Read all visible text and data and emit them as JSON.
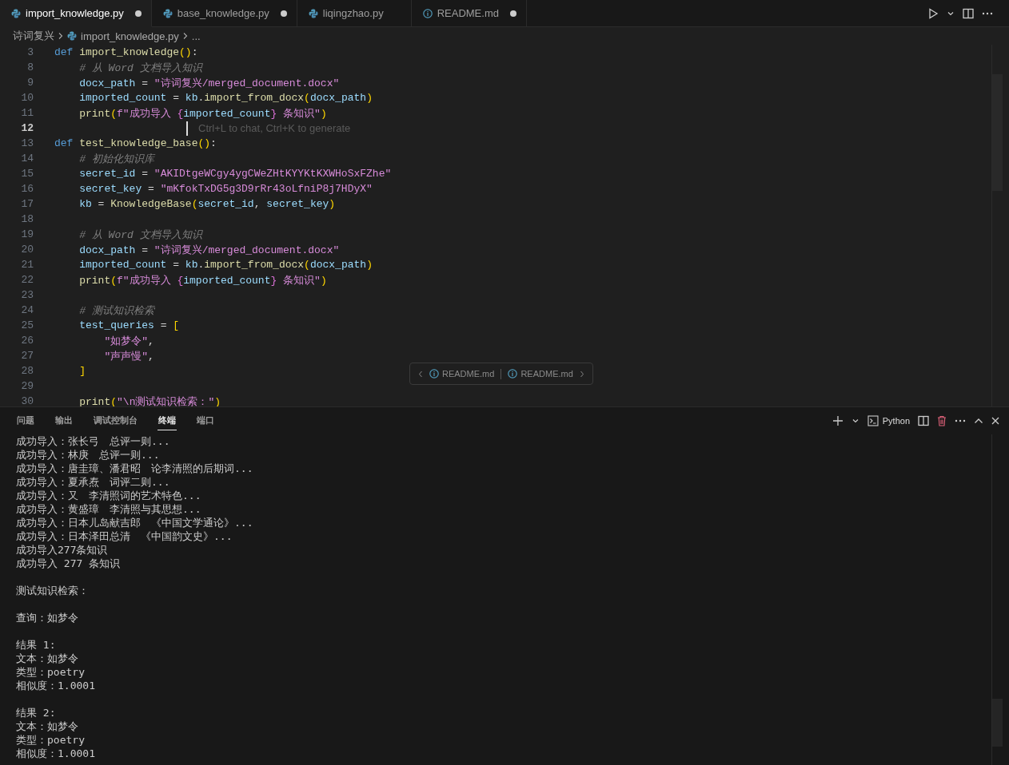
{
  "tabs": [
    {
      "label": "import_knowledge.py",
      "kind": "python",
      "modified": true,
      "selected": true
    },
    {
      "label": "base_knowledge.py",
      "kind": "python",
      "modified": true,
      "selected": false
    },
    {
      "label": "liqingzhao.py",
      "kind": "python",
      "modified": false,
      "selected": false
    },
    {
      "label": "README.md",
      "kind": "info",
      "modified": true,
      "selected": false
    }
  ],
  "breadcrumb": [
    {
      "label": "诗词复兴",
      "kind": "folder"
    },
    {
      "label": "import_knowledge.py",
      "kind": "python"
    },
    {
      "label": "...",
      "kind": "symbol"
    }
  ],
  "editor": {
    "lines": [
      {
        "num": "3",
        "current": false,
        "tokens": [
          {
            "text": "def ",
            "kind": "kw"
          },
          {
            "text": "import_knowledge",
            "kind": "fn"
          },
          {
            "text": "()",
            "kind": "br1"
          },
          {
            "text": ":",
            "kind": "op"
          }
        ]
      },
      {
        "num": "8",
        "current": false,
        "tokens": [
          {
            "text": "    # 从 Word 文档导入知识",
            "kind": "cmt"
          }
        ]
      },
      {
        "num": "9",
        "current": false,
        "tokens": [
          {
            "text": "    docx_path",
            "kind": "var"
          },
          {
            "text": " = ",
            "kind": "op"
          },
          {
            "text": "\"诗词复兴/merged_document.docx\"",
            "kind": "str"
          }
        ]
      },
      {
        "num": "10",
        "current": false,
        "tokens": [
          {
            "text": "    imported_count",
            "kind": "var"
          },
          {
            "text": " = ",
            "kind": "op"
          },
          {
            "text": "kb",
            "kind": "var"
          },
          {
            "text": ".",
            "kind": "op"
          },
          {
            "text": "import_from_docx",
            "kind": "fn"
          },
          {
            "text": "(",
            "kind": "br1"
          },
          {
            "text": "docx_path",
            "kind": "var"
          },
          {
            "text": ")",
            "kind": "br1"
          }
        ]
      },
      {
        "num": "11",
        "current": false,
        "tokens": [
          {
            "text": "    print",
            "kind": "fn"
          },
          {
            "text": "(",
            "kind": "br1"
          },
          {
            "text": "f\"成功导入 ",
            "kind": "str"
          },
          {
            "text": "{",
            "kind": "br2"
          },
          {
            "text": "imported_count",
            "kind": "var"
          },
          {
            "text": "}",
            "kind": "br2"
          },
          {
            "text": " 条知识\"",
            "kind": "str"
          },
          {
            "text": ")",
            "kind": "br1"
          }
        ]
      },
      {
        "num": "12",
        "current": true,
        "hint": "Ctrl+L to chat, Ctrl+K to generate"
      },
      {
        "num": "13",
        "current": false,
        "tokens": [
          {
            "text": "def ",
            "kind": "kw"
          },
          {
            "text": "test_knowledge_base",
            "kind": "fn"
          },
          {
            "text": "()",
            "kind": "br1"
          },
          {
            "text": ":",
            "kind": "op"
          }
        ]
      },
      {
        "num": "14",
        "current": false,
        "tokens": [
          {
            "text": "    # 初始化知识库",
            "kind": "cmt"
          }
        ]
      },
      {
        "num": "15",
        "current": false,
        "tokens": [
          {
            "text": "    secret_id",
            "kind": "var"
          },
          {
            "text": " = ",
            "kind": "op"
          },
          {
            "text": "\"AKIDtgeWCgy4ygCWeZHtKYYKtKXWHoSxFZhe\"",
            "kind": "str"
          }
        ]
      },
      {
        "num": "16",
        "current": false,
        "tokens": [
          {
            "text": "    secret_key",
            "kind": "var"
          },
          {
            "text": " = ",
            "kind": "op"
          },
          {
            "text": "\"mKfokTxDG5g3D9rRr43oLfniP8j7HDyX\"",
            "kind": "str"
          }
        ]
      },
      {
        "num": "17",
        "current": false,
        "tokens": [
          {
            "text": "    kb",
            "kind": "var"
          },
          {
            "text": " = ",
            "kind": "op"
          },
          {
            "text": "KnowledgeBase",
            "kind": "fn"
          },
          {
            "text": "(",
            "kind": "br1"
          },
          {
            "text": "secret_id",
            "kind": "var"
          },
          {
            "text": ", ",
            "kind": "op"
          },
          {
            "text": "secret_key",
            "kind": "var"
          },
          {
            "text": ")",
            "kind": "br1"
          }
        ]
      },
      {
        "num": "18",
        "current": false
      },
      {
        "num": "19",
        "current": false,
        "tokens": [
          {
            "text": "    # 从 Word 文档导入知识",
            "kind": "cmt"
          }
        ]
      },
      {
        "num": "20",
        "current": false,
        "tokens": [
          {
            "text": "    docx_path",
            "kind": "var"
          },
          {
            "text": " = ",
            "kind": "op"
          },
          {
            "text": "\"诗词复兴/merged_document.docx\"",
            "kind": "str"
          }
        ]
      },
      {
        "num": "21",
        "current": false,
        "tokens": [
          {
            "text": "    imported_count",
            "kind": "var"
          },
          {
            "text": " = ",
            "kind": "op"
          },
          {
            "text": "kb",
            "kind": "var"
          },
          {
            "text": ".",
            "kind": "op"
          },
          {
            "text": "import_from_docx",
            "kind": "fn"
          },
          {
            "text": "(",
            "kind": "br1"
          },
          {
            "text": "docx_path",
            "kind": "var"
          },
          {
            "text": ")",
            "kind": "br1"
          }
        ]
      },
      {
        "num": "22",
        "current": false,
        "tokens": [
          {
            "text": "    print",
            "kind": "fn"
          },
          {
            "text": "(",
            "kind": "br1"
          },
          {
            "text": "f\"成功导入 ",
            "kind": "str"
          },
          {
            "text": "{",
            "kind": "br2"
          },
          {
            "text": "imported_count",
            "kind": "var"
          },
          {
            "text": "}",
            "kind": "br2"
          },
          {
            "text": " 条知识\"",
            "kind": "str"
          },
          {
            "text": ")",
            "kind": "br1"
          }
        ]
      },
      {
        "num": "23",
        "current": false
      },
      {
        "num": "24",
        "current": false,
        "tokens": [
          {
            "text": "    # 测试知识检索",
            "kind": "cmt"
          }
        ]
      },
      {
        "num": "25",
        "current": false,
        "tokens": [
          {
            "text": "    test_queries",
            "kind": "var"
          },
          {
            "text": " = ",
            "kind": "op"
          },
          {
            "text": "[",
            "kind": "br1"
          }
        ]
      },
      {
        "num": "26",
        "current": false,
        "tokens": [
          {
            "text": "        \"如梦令\"",
            "kind": "str"
          },
          {
            "text": ",",
            "kind": "op"
          }
        ]
      },
      {
        "num": "27",
        "current": false,
        "tokens": [
          {
            "text": "        \"声声慢\"",
            "kind": "str"
          },
          {
            "text": ",",
            "kind": "op"
          }
        ]
      },
      {
        "num": "28",
        "current": false,
        "tokens": [
          {
            "text": "    ]",
            "kind": "br1"
          }
        ]
      },
      {
        "num": "29",
        "current": false
      },
      {
        "num": "30",
        "current": false,
        "tokens": [
          {
            "text": "    print",
            "kind": "fn"
          },
          {
            "text": "(",
            "kind": "br1"
          },
          {
            "text": "\"\\n测试知识检索：\"",
            "kind": "str"
          },
          {
            "text": ")",
            "kind": "br1"
          }
        ]
      }
    ],
    "nav_widget": [
      "README.md",
      "README.md"
    ]
  },
  "panel": {
    "tabs": [
      {
        "label": "问题",
        "selected": false
      },
      {
        "label": "输出",
        "selected": false
      },
      {
        "label": "调试控制台",
        "selected": false
      },
      {
        "label": "终端",
        "selected": true
      },
      {
        "label": "端口",
        "selected": false
      }
    ],
    "terminal_name": "Python",
    "terminal_blocks": [
      [
        "成功导入：张长弓　总评一则...",
        "成功导入：林庚　总评一则...",
        "成功导入：唐圭璋、潘君昭　论李清照的后期词...",
        "成功导入：夏承焘　词评二则...",
        "成功导入：又　李清照词的艺术特色...",
        "成功导入：黄盛璋　李清照与其思想...",
        "成功导入：日本儿岛献吉郎　《中国文学通论》...",
        "成功导入：日本泽田总清　《中国韵文史》...",
        "成功导入277条知识",
        "成功导入 277 条知识"
      ],
      [
        "测试知识检索："
      ],
      [
        "查询：如梦令"
      ],
      [
        "结果 1:",
        "文本：如梦令",
        "类型：poetry",
        "相似度：1.0001"
      ],
      [
        "结果 2:",
        "文本：如梦令",
        "类型：poetry",
        "相似度：1.0001"
      ]
    ]
  }
}
